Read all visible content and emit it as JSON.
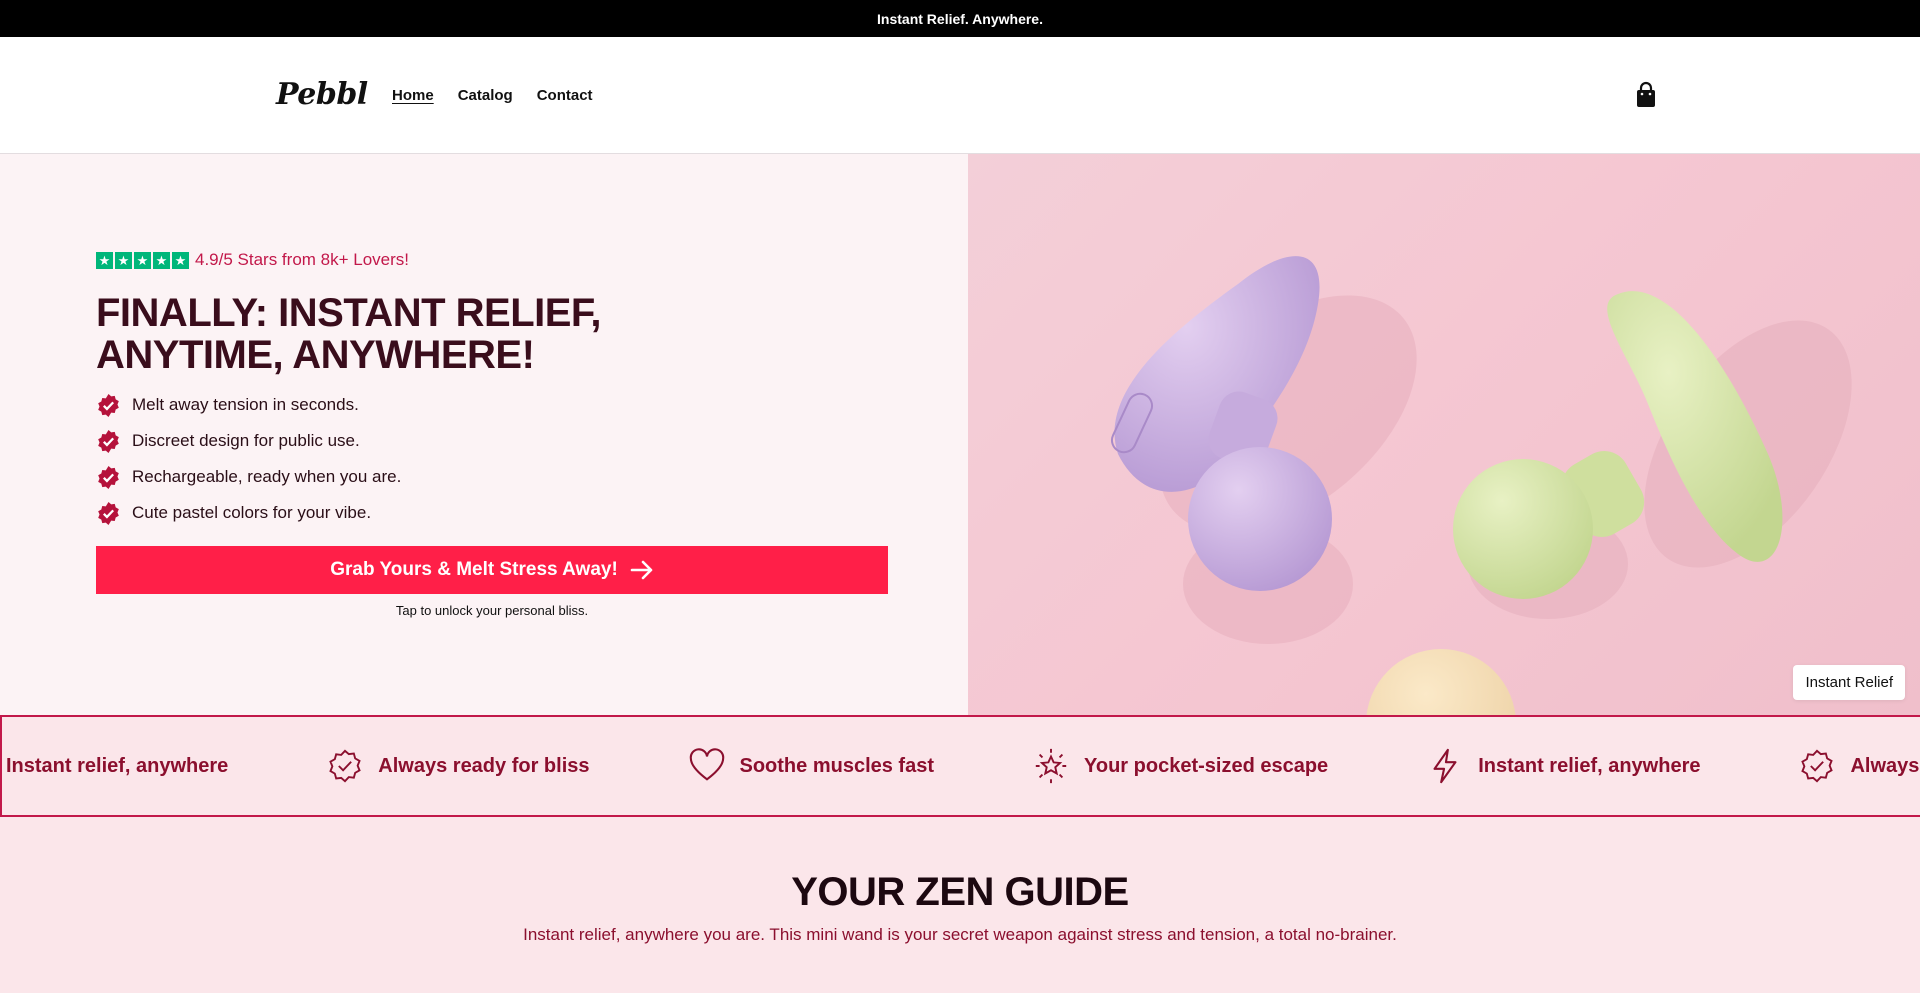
{
  "announcement": "Instant Relief. Anywhere.",
  "header": {
    "logo": "Pebbl",
    "nav": [
      {
        "label": "Home",
        "active": true
      },
      {
        "label": "Catalog",
        "active": false
      },
      {
        "label": "Contact",
        "active": false
      }
    ],
    "cart_icon": "shopping-bag-icon"
  },
  "hero": {
    "rating_text": "4.9/5 Stars from 8k+ Lovers!",
    "title": "FINALLY: INSTANT RELIEF, ANYTIME, ANYWHERE!",
    "bullets": [
      "Melt away tension in seconds.",
      "Discreet design for public use.",
      "Rechargeable, ready when you are.",
      "Cute pastel colors for your vibe."
    ],
    "cta_label": "Grab Yours & Melt Stress Away!",
    "cta_subtext": "Tap to unlock your personal bliss.",
    "image_label": "Instant Relief"
  },
  "marquee": [
    {
      "label": "Instant relief, anywhere",
      "icon": "lightning-icon"
    },
    {
      "label": "Always ready for bliss",
      "icon": "verified-badge-icon"
    },
    {
      "label": "Soothe muscles fast",
      "icon": "heart-icon"
    },
    {
      "label": "Your pocket-sized escape",
      "icon": "sparkle-star-icon"
    },
    {
      "label": "Instant relief, anywhere",
      "icon": "lightning-icon"
    },
    {
      "label": "Always ready for bliss",
      "icon": "verified-badge-icon"
    }
  ],
  "zen": {
    "title": "YOUR ZEN GUIDE",
    "subtitle": "Instant relief, anywhere you are. This mini wand is your secret weapon against stress and tension, a total no-brainer."
  },
  "colors": {
    "accent": "#ff1f48",
    "deep": "#8b0f2e",
    "trustpilot": "#00b67a"
  }
}
